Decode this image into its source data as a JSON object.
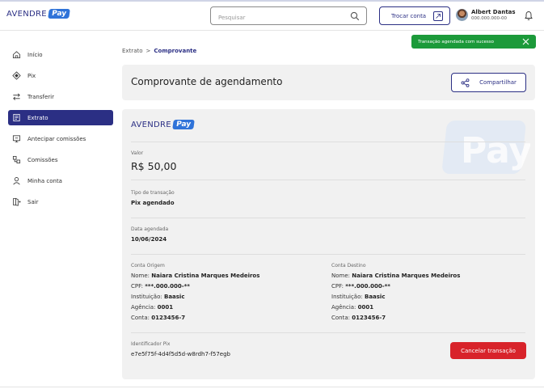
{
  "brand": {
    "name": "AVENDRE",
    "badge": "Pay",
    "accent": "#2b2f84",
    "badge_color": "#2f73d9"
  },
  "header": {
    "search_placeholder": "Pesquisar",
    "switch_account_label": "Trocar conta",
    "user": {
      "name": "Albert Dantas",
      "document": "000.000.000-00"
    }
  },
  "sidebar": {
    "items": [
      {
        "label": "Início",
        "icon": "home-icon",
        "active": false
      },
      {
        "label": "Pix",
        "icon": "pix-icon",
        "active": false
      },
      {
        "label": "Transferir",
        "icon": "transfer-icon",
        "active": false
      },
      {
        "label": "Extrato",
        "icon": "statement-icon",
        "active": true
      },
      {
        "label": "Antecipar comissões",
        "icon": "anticipate-icon",
        "active": false
      },
      {
        "label": "Comissões",
        "icon": "commissions-icon",
        "active": false
      },
      {
        "label": "Minha conta",
        "icon": "user-icon",
        "active": false
      },
      {
        "label": "Sair",
        "icon": "logout-icon",
        "active": false
      }
    ]
  },
  "toast": {
    "message": "Transação agendada com sucesso",
    "color": "#1c9a3a"
  },
  "breadcrumb": {
    "parent": "Extrato",
    "separator": ">",
    "current": "Comprovante"
  },
  "page": {
    "title": "Comprovante de agendamento",
    "share_label": "Compartilhar"
  },
  "receipt": {
    "amount_label": "Valor",
    "amount": "R$ 50,00",
    "type_label": "Tipo de transação",
    "type": "Pix agendado",
    "date_label": "Data agendada",
    "date": "10/06/2024",
    "origin": {
      "title": "Conta Origem",
      "name_label": "Nome:",
      "name": "Naiara Cristina Marques Medeiros",
      "cpf_label": "CPF:",
      "cpf": "***.000.000-**",
      "institution_label": "Instituição:",
      "institution": "Baasic",
      "agency_label": "Agência:",
      "agency": "0001",
      "account_label": "Conta:",
      "account": "0123456-7"
    },
    "destination": {
      "title": "Conta Destino",
      "name_label": "Nome:",
      "name": "Naiara Cristina Marques Medeiros",
      "cpf_label": "CPF:",
      "cpf": "***.000.000-**",
      "institution_label": "Instituição:",
      "institution": "Baasic",
      "agency_label": "Agência:",
      "agency": "0001",
      "account_label": "Conta:",
      "account": "0123456-7"
    },
    "pix_id_label": "Identificador Pix",
    "pix_id": "e7e5f75f-4d4f5d5d-w8rdh7-f57egb",
    "cancel_label": "Cancelar transação",
    "cancel_color": "#d8232a"
  }
}
